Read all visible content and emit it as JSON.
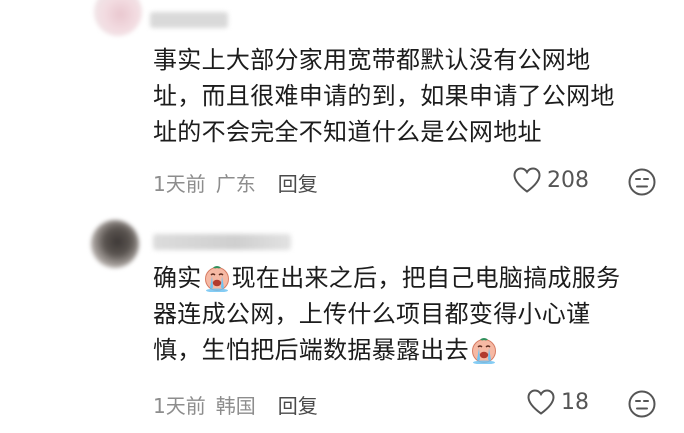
{
  "comments": [
    {
      "lines": [
        "事实上大部分家用宽带都默认没有公网地",
        "址，而且很难申请的到，如果申请了公网地",
        "址的不会完全不知道什么是公网地址"
      ],
      "time": "1天前",
      "location": "广东",
      "reply_label": "回复",
      "likes": "208"
    },
    {
      "line1_before": "确实",
      "line1_after": "现在出来之后，把自己电脑搞成服务",
      "line2": "器连成公网，上传什么项目都变得小心谨",
      "line3_before": "慎，生怕把后端数据暴露出去",
      "emojis": [
        "crying-face-emoji",
        "crying-face-emoji"
      ],
      "time": "1天前",
      "location": "韩国",
      "reply_label": "回复",
      "likes": "18"
    }
  ],
  "icons": {
    "like": "heart-outline-icon",
    "dislike": "unhappy-face-icon"
  },
  "colors": {
    "text": "#1c1c1c",
    "meta": "#8d8d8d",
    "reply": "#4a4a4a",
    "icon": "#555555"
  }
}
